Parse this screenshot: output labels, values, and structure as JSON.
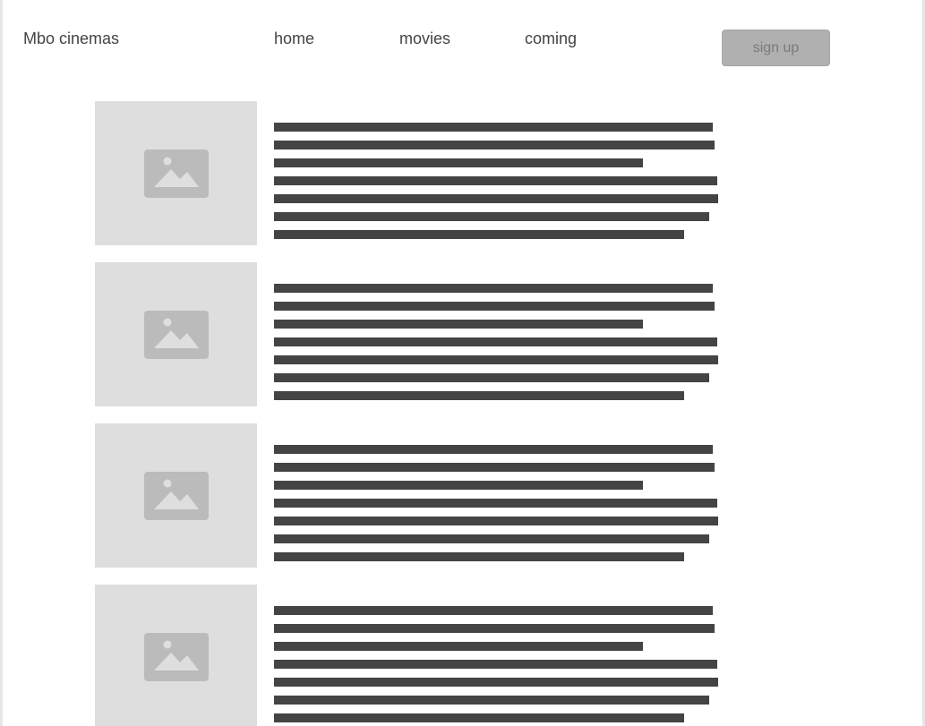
{
  "header": {
    "brand": "Mbo cinemas",
    "nav": [
      {
        "label": "home"
      },
      {
        "label": "movies"
      },
      {
        "label": "coming"
      }
    ],
    "signup_label": "sign up"
  },
  "movies": [
    {
      "image_icon": "image-placeholder-icon"
    },
    {
      "image_icon": "image-placeholder-icon"
    },
    {
      "image_icon": "image-placeholder-icon"
    },
    {
      "image_icon": "image-placeholder-icon"
    }
  ],
  "colors": {
    "text": "#444444",
    "placeholder_bg": "#dedede",
    "placeholder_icon": "#bbbbbb",
    "button_bg": "#b0b0b0",
    "button_text": "#7a7a7a"
  }
}
